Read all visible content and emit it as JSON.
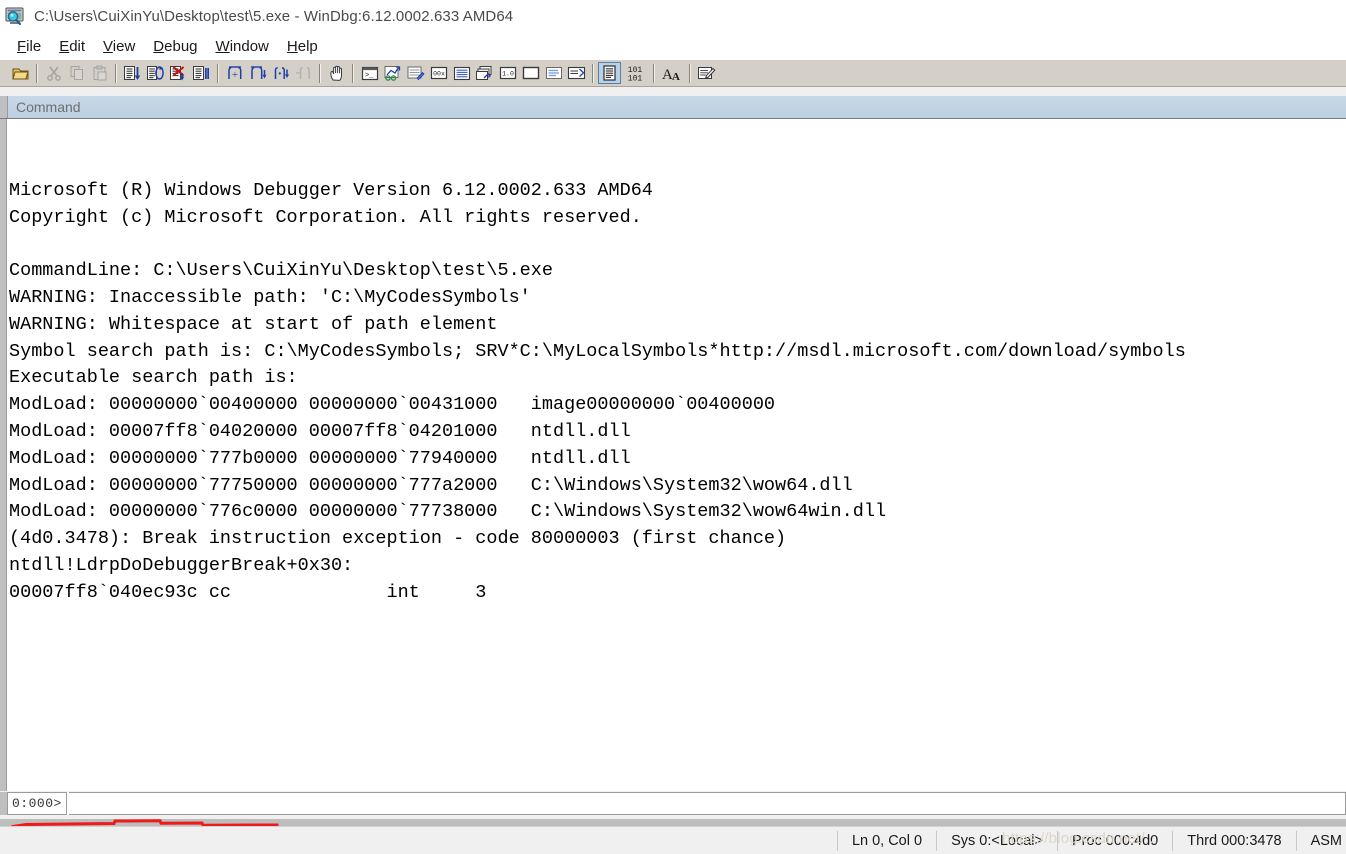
{
  "window": {
    "title": "C:\\Users\\CuiXinYu\\Desktop\\test\\5.exe - WinDbg:6.12.0002.633 AMD64",
    "icon": "windbg-app-icon"
  },
  "menubar": {
    "items": [
      {
        "name": "file",
        "pre": "F",
        "rest": "ile"
      },
      {
        "name": "edit",
        "pre": "E",
        "rest": "dit"
      },
      {
        "name": "view",
        "pre": "V",
        "rest": "iew"
      },
      {
        "name": "debug",
        "pre": "D",
        "rest": "ebug"
      },
      {
        "name": "window",
        "pre": "W",
        "rest": "indow"
      },
      {
        "name": "help",
        "pre": "H",
        "rest": "elp"
      }
    ]
  },
  "toolbar": {
    "buttons": [
      {
        "name": "open-file-icon",
        "enabled": true
      },
      {
        "name": "cut-icon",
        "enabled": false
      },
      {
        "name": "copy-icon",
        "enabled": false
      },
      {
        "name": "paste-icon",
        "enabled": false
      },
      {
        "name": "step-into-icon",
        "enabled": true
      },
      {
        "name": "step-over-icon",
        "enabled": true
      },
      {
        "name": "stop-debugging-icon",
        "enabled": true
      },
      {
        "name": "restart-icon",
        "enabled": true
      },
      {
        "name": "step-out-braces-icon",
        "enabled": true
      },
      {
        "name": "step-over-braces-icon",
        "enabled": true
      },
      {
        "name": "step-into-braces-icon",
        "enabled": true
      },
      {
        "name": "run-to-cursor-icon",
        "enabled": false
      },
      {
        "name": "break-hand-icon",
        "enabled": true
      },
      {
        "name": "command-window-icon",
        "enabled": true
      },
      {
        "name": "watch-window-icon",
        "enabled": true
      },
      {
        "name": "locals-window-icon",
        "enabled": true
      },
      {
        "name": "registers-window-icon",
        "enabled": true
      },
      {
        "name": "memory-window-icon",
        "enabled": true
      },
      {
        "name": "call-stack-window-icon",
        "enabled": true
      },
      {
        "name": "disassembly-window-icon",
        "enabled": true
      },
      {
        "name": "scratch-pad-icon",
        "enabled": true
      },
      {
        "name": "processes-window-icon",
        "enabled": true
      },
      {
        "name": "source-window-icon",
        "enabled": true
      },
      {
        "name": "source-mode-icon",
        "enabled": true,
        "pressed": true
      },
      {
        "name": "assembly-mode-icon",
        "enabled": true
      },
      {
        "name": "font-icon",
        "enabled": true
      },
      {
        "name": "log-file-icon",
        "enabled": true
      }
    ]
  },
  "command_window": {
    "caption": "Command",
    "output_lines": [
      "",
      "Microsoft (R) Windows Debugger Version 6.12.0002.633 AMD64",
      "Copyright (c) Microsoft Corporation. All rights reserved.",
      "",
      "CommandLine: C:\\Users\\CuiXinYu\\Desktop\\test\\5.exe",
      "WARNING: Inaccessible path: 'C:\\MyCodesSymbols'",
      "WARNING: Whitespace at start of path element",
      "Symbol search path is: C:\\MyCodesSymbols; SRV*C:\\MyLocalSymbols*http://msdl.microsoft.com/download/symbols",
      "Executable search path is:",
      "ModLoad: 00000000`00400000 00000000`00431000   image00000000`00400000",
      "ModLoad: 00007ff8`04020000 00007ff8`04201000   ntdll.dll",
      "ModLoad: 00000000`777b0000 00000000`77940000   ntdll.dll",
      "ModLoad: 00000000`77750000 00000000`777a2000   C:\\Windows\\System32\\wow64.dll",
      "ModLoad: 00000000`776c0000 00000000`77738000   C:\\Windows\\System32\\wow64win.dll",
      "(4d0.3478): Break instruction exception - code 80000003 (first chance)",
      "ntdll!LdrpDoDebuggerBreak+0x30:",
      "00007ff8`040ec93c cc              int     3"
    ],
    "prompt_label": "0:000>",
    "prompt_value": "",
    "prompt_placeholder": ""
  },
  "statusbar": {
    "cells": [
      {
        "name": "cursor-position",
        "text": "Ln 0, Col 0"
      },
      {
        "name": "system-target",
        "text": "Sys 0:<Local>"
      },
      {
        "name": "process-id",
        "text": "Proc 000:4d0"
      },
      {
        "name": "thread-id",
        "text": "Thrd 000:3478"
      },
      {
        "name": "mode-indicator",
        "text": "ASM"
      }
    ],
    "watermark": "https://blog.csdn.net/..."
  },
  "colors": {
    "toolbar_bg": "#d4d0c8",
    "caption_bg": "#c5d5e6",
    "annotation_red": "#ee1b1b",
    "text": "#000000"
  }
}
